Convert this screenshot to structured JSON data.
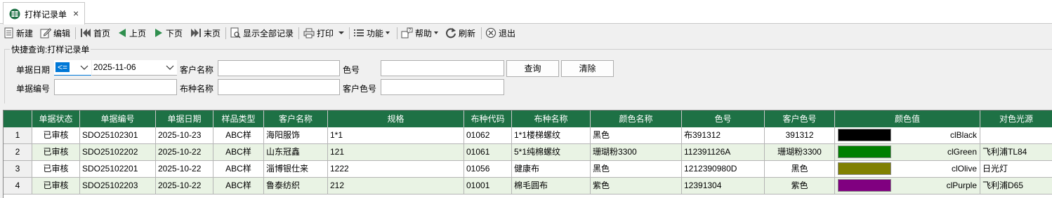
{
  "tab": {
    "title": "打样记录单",
    "icon": "grid-document-icon",
    "close": "×"
  },
  "toolbar": {
    "new": "新建",
    "edit": "编辑",
    "first": "首页",
    "prev": "上页",
    "next": "下页",
    "last": "末页",
    "show_all": "显示全部记录",
    "print": "打印",
    "function": "功能",
    "help": "帮助",
    "refresh": "刷新",
    "exit": "退出"
  },
  "quick": {
    "title": "快捷查询:打样记录单",
    "date_label": "单据日期",
    "date_op": "<=",
    "date_value": "2025-11-06",
    "customer_label": "客户名称",
    "customer_value": "",
    "color_no_label": "色号",
    "color_no_value": "",
    "doc_no_label": "单据编号",
    "doc_no_value": "",
    "fabric_label": "布种名称",
    "fabric_value": "",
    "cust_color_label": "客户色号",
    "cust_color_value": "",
    "query_button": "查询",
    "clear_button": "清除"
  },
  "grid": {
    "columns": [
      "",
      "单据状态",
      "单据编号",
      "单据日期",
      "样品类型",
      "客户名称",
      "规格",
      "布种代码",
      "布种名称",
      "颜色名称",
      "色号",
      "客户色号",
      "颜色值",
      "对色光源"
    ],
    "rows": [
      {
        "n": "1",
        "status": "已审核",
        "doc_no": "SDO25102301",
        "date": "2025-10-23",
        "type": "ABC样",
        "customer": "海阳服饰",
        "spec": "1*1",
        "fabric_code": "01062",
        "fabric_name": "1*1楼梯螺纹",
        "color_name": "黑色",
        "color_no": "布391312",
        "cust_color": "391312",
        "color_value": "clBlack",
        "swatch": "#000000",
        "light": ""
      },
      {
        "n": "2",
        "status": "已审核",
        "doc_no": "SDO25102202",
        "date": "2025-10-22",
        "type": "ABC样",
        "customer": "山东冠鑫",
        "spec": "121",
        "fabric_code": "01061",
        "fabric_name": "5*1纯棉螺纹",
        "color_name": "珊瑚粉3300",
        "color_no": "112391126A",
        "cust_color": "珊瑚粉3300",
        "color_value": "clGreen",
        "swatch": "#008000",
        "light": "飞利浦TL84"
      },
      {
        "n": "3",
        "status": "已审核",
        "doc_no": "SDO25102201",
        "date": "2025-10-22",
        "type": "ABC样",
        "customer": "淄博银仕来",
        "spec": "1222",
        "fabric_code": "01056",
        "fabric_name": "健康布",
        "color_name": "黑色",
        "color_no": "1212390980D",
        "cust_color": "黑色",
        "color_value": "clOlive",
        "swatch": "#808000",
        "light": "日光灯"
      },
      {
        "n": "4",
        "status": "已审核",
        "doc_no": "SDO25102203",
        "date": "2025-10-22",
        "type": "ABC样",
        "customer": "鲁泰纺织",
        "spec": "212",
        "fabric_code": "01001",
        "fabric_name": "棉毛圆布",
        "color_name": "紫色",
        "color_no": "12391304",
        "cust_color": "紫色",
        "color_value": "clPurple",
        "swatch": "#800080",
        "light": "飞利浦D65"
      }
    ]
  },
  "colors": {
    "header_bg": "#1e7145",
    "row_even": "#ffffff",
    "row_odd": "#e9f3e4",
    "selection": "#0078d7"
  }
}
